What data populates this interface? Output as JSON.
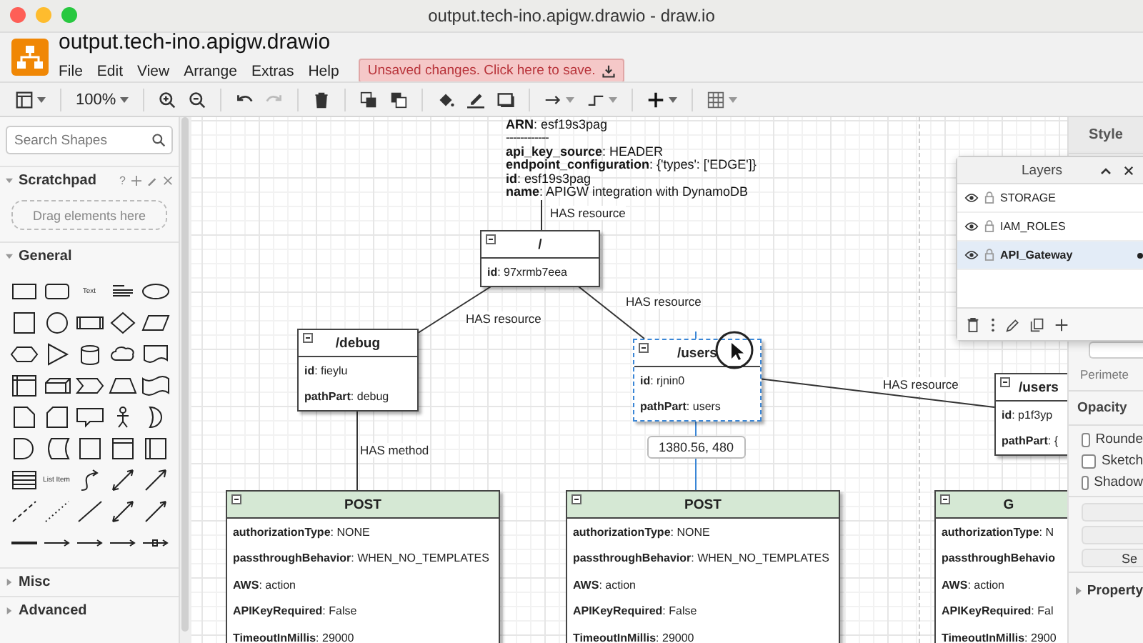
{
  "window": {
    "title": "output.tech-ino.apigw.drawio - draw.io"
  },
  "header": {
    "filename": "output.tech-ino.apigw.drawio",
    "menu": [
      "File",
      "Edit",
      "View",
      "Arrange",
      "Extras",
      "Help"
    ],
    "save_notice": "Unsaved changes. Click here to save."
  },
  "toolbar": {
    "zoom": "100%",
    "redo": {
      "disabled": true
    }
  },
  "sidebar": {
    "search": {
      "placeholder": "Search Shapes"
    },
    "sections": [
      {
        "title": "Scratchpad",
        "kind": "scratchpad",
        "expanded": true,
        "help": "?",
        "hint": "Drag elements here"
      },
      {
        "title": "General",
        "kind": "shapes",
        "expanded": true,
        "shape_labels": [
          "Text",
          "List Item"
        ]
      },
      {
        "title": "Misc",
        "kind": "plain",
        "expanded": false
      },
      {
        "title": "Advanced",
        "kind": "plain",
        "expanded": false
      }
    ]
  },
  "canvas": {
    "info_block": [
      {
        "kind": "field",
        "text": "**ARN**: esf19s3pag"
      },
      {
        "kind": "separator",
        "text": "------------"
      },
      {
        "kind": "field",
        "text": "**api_key_source**: HEADER"
      },
      {
        "kind": "field",
        "text": "**endpoint_configuration**: {'types': ['EDGE']}"
      },
      {
        "kind": "field",
        "text": "**id**: esf19s3pag"
      },
      {
        "kind": "field",
        "text": "**name**: APIGW integration with DynamoDB"
      }
    ],
    "edge_labels": [
      "HAS resource",
      "HAS resource",
      "HAS resource",
      "HAS resource",
      "HAS method"
    ],
    "nodes": [
      {
        "title": "/",
        "kind": "resource",
        "selected": false,
        "fields": [
          "**id**: 97xrmb7eea"
        ]
      },
      {
        "title": "/debug",
        "kind": "resource",
        "selected": false,
        "fields": [
          "**id**: fieylu",
          "**pathPart**: debug"
        ]
      },
      {
        "title": "/users",
        "kind": "resource",
        "selected": true,
        "fields": [
          "**id**: rjnin0",
          "**pathPart**: users"
        ]
      },
      {
        "title": "/users",
        "kind": "resource",
        "selected": false,
        "fields": [
          "**id**: p1f3yp",
          "**pathPart**: {"
        ]
      },
      {
        "title": "POST",
        "kind": "method",
        "selected": false,
        "fields": [
          "**authorizationType**: NONE",
          "**passthroughBehavior**: WHEN_NO_TEMPLATES",
          "**AWS**: action",
          "**APIKeyRequired**: False",
          "**TimeoutInMillis**: 29000"
        ]
      },
      {
        "title": "POST",
        "kind": "method",
        "selected": false,
        "fields": [
          "**authorizationType**: NONE",
          "**passthroughBehavior**: WHEN_NO_TEMPLATES",
          "**AWS**: action",
          "**APIKeyRequired**: False",
          "**TimeoutInMillis**: 29000"
        ]
      },
      {
        "title": "G",
        "kind": "method",
        "selected": false,
        "fields": [
          "**authorizationType**: N",
          "**passthroughBehavio**",
          "**AWS**: action",
          "**APIKeyRequired**: Fal",
          "**TimeoutInMillis**: 2900"
        ]
      }
    ],
    "tooltip": "1380.56, 480"
  },
  "format_panel": {
    "tab": "Style",
    "perimeter_label": "Perimete",
    "opacity_label": "Opacity",
    "options": [
      {
        "label": "Rounde",
        "checked": false
      },
      {
        "label": "Sketch",
        "checked": false
      },
      {
        "label": "Shadow",
        "checked": false
      }
    ],
    "set_button": "Se",
    "property_section": {
      "title": "Property",
      "expanded": false
    }
  },
  "layers_panel": {
    "title": "Layers",
    "layers": [
      {
        "name": "STORAGE",
        "selected": false
      },
      {
        "name": "IAM_ROLES",
        "selected": false
      },
      {
        "name": "API_Gateway",
        "selected": true
      }
    ]
  }
}
